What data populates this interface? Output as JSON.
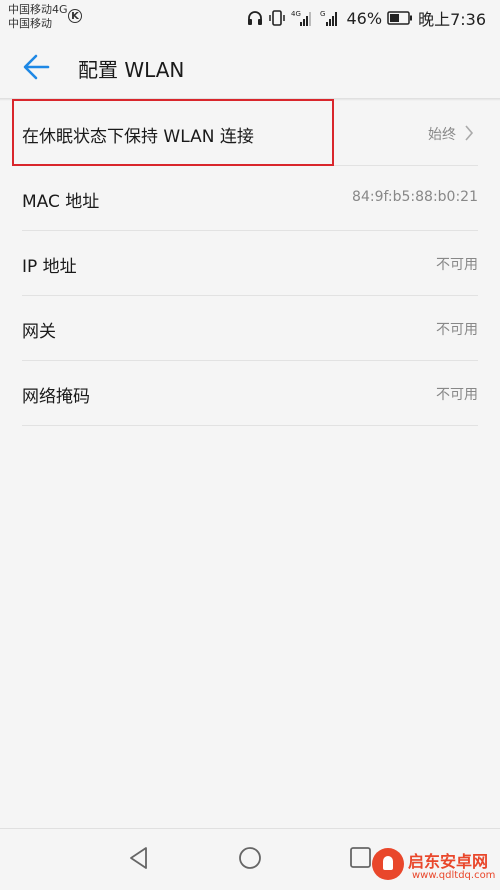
{
  "status_bar": {
    "carrier_line1": "中国移动4G",
    "carrier_line2": "中国移动",
    "k_icon_letter": "K",
    "battery_percent": "46%",
    "time": "晚上7:36"
  },
  "header": {
    "title": "配置 WLAN"
  },
  "settings": [
    {
      "label": "在休眠状态下保持 WLAN 连接",
      "value": "始终",
      "has_chevron": true
    },
    {
      "label": "MAC 地址",
      "value": "84:9f:b5:88:b0:21"
    },
    {
      "label": "IP 地址",
      "value": "不可用"
    },
    {
      "label": "网关",
      "value": "不可用"
    },
    {
      "label": "网络掩码",
      "value": "不可用"
    }
  ],
  "watermark": {
    "brand": "启东安卓网",
    "url": "www.qdltdq.com"
  },
  "colors": {
    "accent": "#1e88e5",
    "highlight_box": "#d9262c",
    "watermark": "#e9472b"
  }
}
